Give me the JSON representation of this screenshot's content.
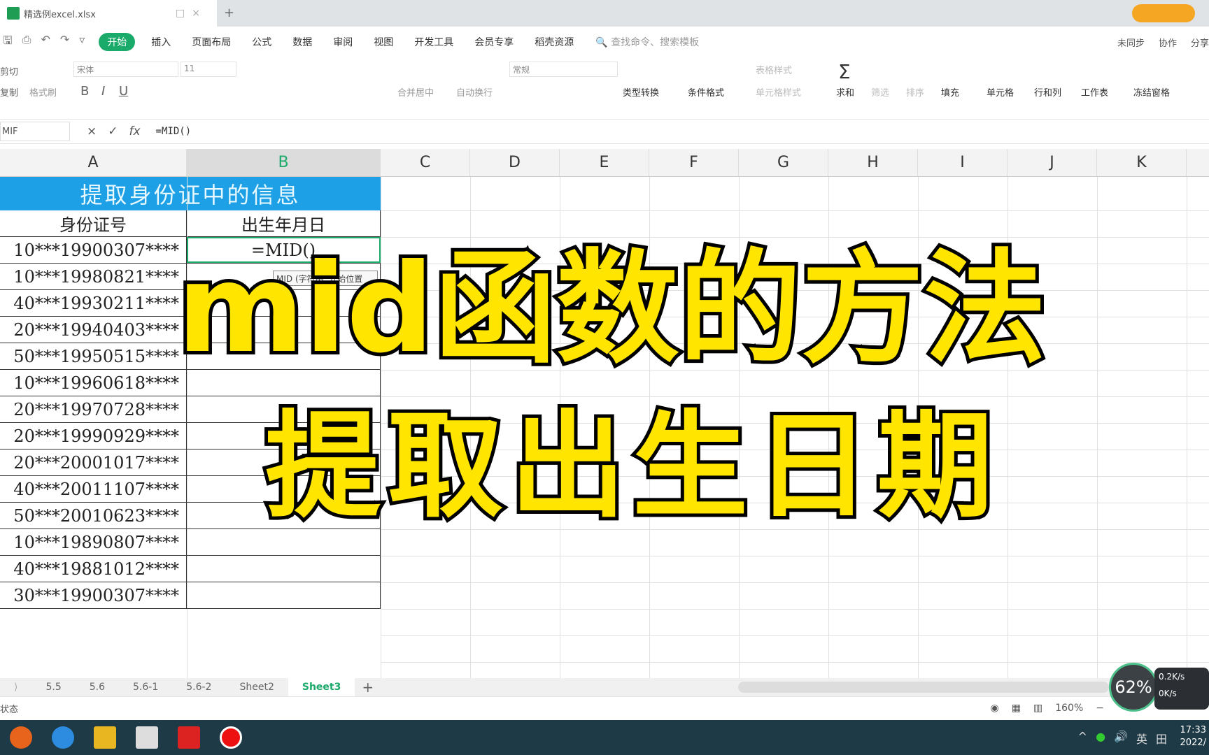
{
  "window": {
    "file_tab": "精选例excel.xlsx",
    "new_tab": "+"
  },
  "menu": {
    "items": [
      "开始",
      "插入",
      "页面布局",
      "公式",
      "数据",
      "审阅",
      "视图",
      "开发工具",
      "会员专享",
      "稻壳资源"
    ],
    "search": "查找命令、搜索模板",
    "right": [
      "未同步",
      "协作",
      "分享"
    ]
  },
  "toolbar": {
    "paste_cut": "剪切",
    "copy": "复制",
    "format_painter": "格式刷",
    "font": "宋体",
    "font_size": "11",
    "number_format": "常规",
    "merge": "合并居中",
    "wrap": "自动换行",
    "convert": "类型转换",
    "cond_format": "条件格式",
    "table_style": "表格样式",
    "cell_style": "单元格样式",
    "sum": "求和",
    "filter": "筛选",
    "sort": "排序",
    "fill": "填充",
    "cell": "单元格",
    "rowcol": "行和列",
    "sheet": "工作表",
    "freeze": "冻结窗格",
    "bold": "B",
    "italic": "I",
    "underline": "U"
  },
  "formula_bar": {
    "name_box": "MIF",
    "cancel": "×",
    "confirm": "✓",
    "fx": "fx",
    "formula": "=MID()"
  },
  "columns": [
    "A",
    "B",
    "C",
    "D",
    "E",
    "F",
    "G",
    "H",
    "I",
    "J",
    "K"
  ],
  "sheet": {
    "title": "提取身份证中的信息",
    "headers": [
      "身份证号",
      "出生年月日"
    ],
    "rows": [
      [
        "10***19900307****",
        "=MID()"
      ],
      [
        "10***19980821****",
        ""
      ],
      [
        "40***19930211****",
        ""
      ],
      [
        "20***19940403****",
        ""
      ],
      [
        "50***19950515****",
        ""
      ],
      [
        "10***19960618****",
        ""
      ],
      [
        "20***19970728****",
        ""
      ],
      [
        "20***19990929****",
        ""
      ],
      [
        "20***20001017****",
        ""
      ],
      [
        "40***20011107****",
        ""
      ],
      [
        "50***20010623****",
        ""
      ],
      [
        "10***19890807****",
        ""
      ],
      [
        "40***19881012****",
        ""
      ],
      [
        "30***19900307****",
        ""
      ]
    ],
    "tooltip": "MID (字符串, 开始位置"
  },
  "overlay": {
    "line1": "mid函数的方法",
    "line2": "提取出生日期"
  },
  "sheet_tabs": [
    "5.5",
    "5.6",
    "5.6-1",
    "5.6-2",
    "Sheet2",
    "Sheet3"
  ],
  "active_sheet": "Sheet3",
  "status": {
    "left": "状态",
    "zoom": "160%",
    "gauge": "62%",
    "net_up": "0.2K/s",
    "net_down": "0K/s"
  },
  "taskbar": {
    "ime": "英",
    "time": "17:33",
    "date": "2022/"
  },
  "colors": {
    "accent": "#1aaa6a",
    "title_fill": "#1ea0e6",
    "overlay_text": "#ffe500"
  }
}
